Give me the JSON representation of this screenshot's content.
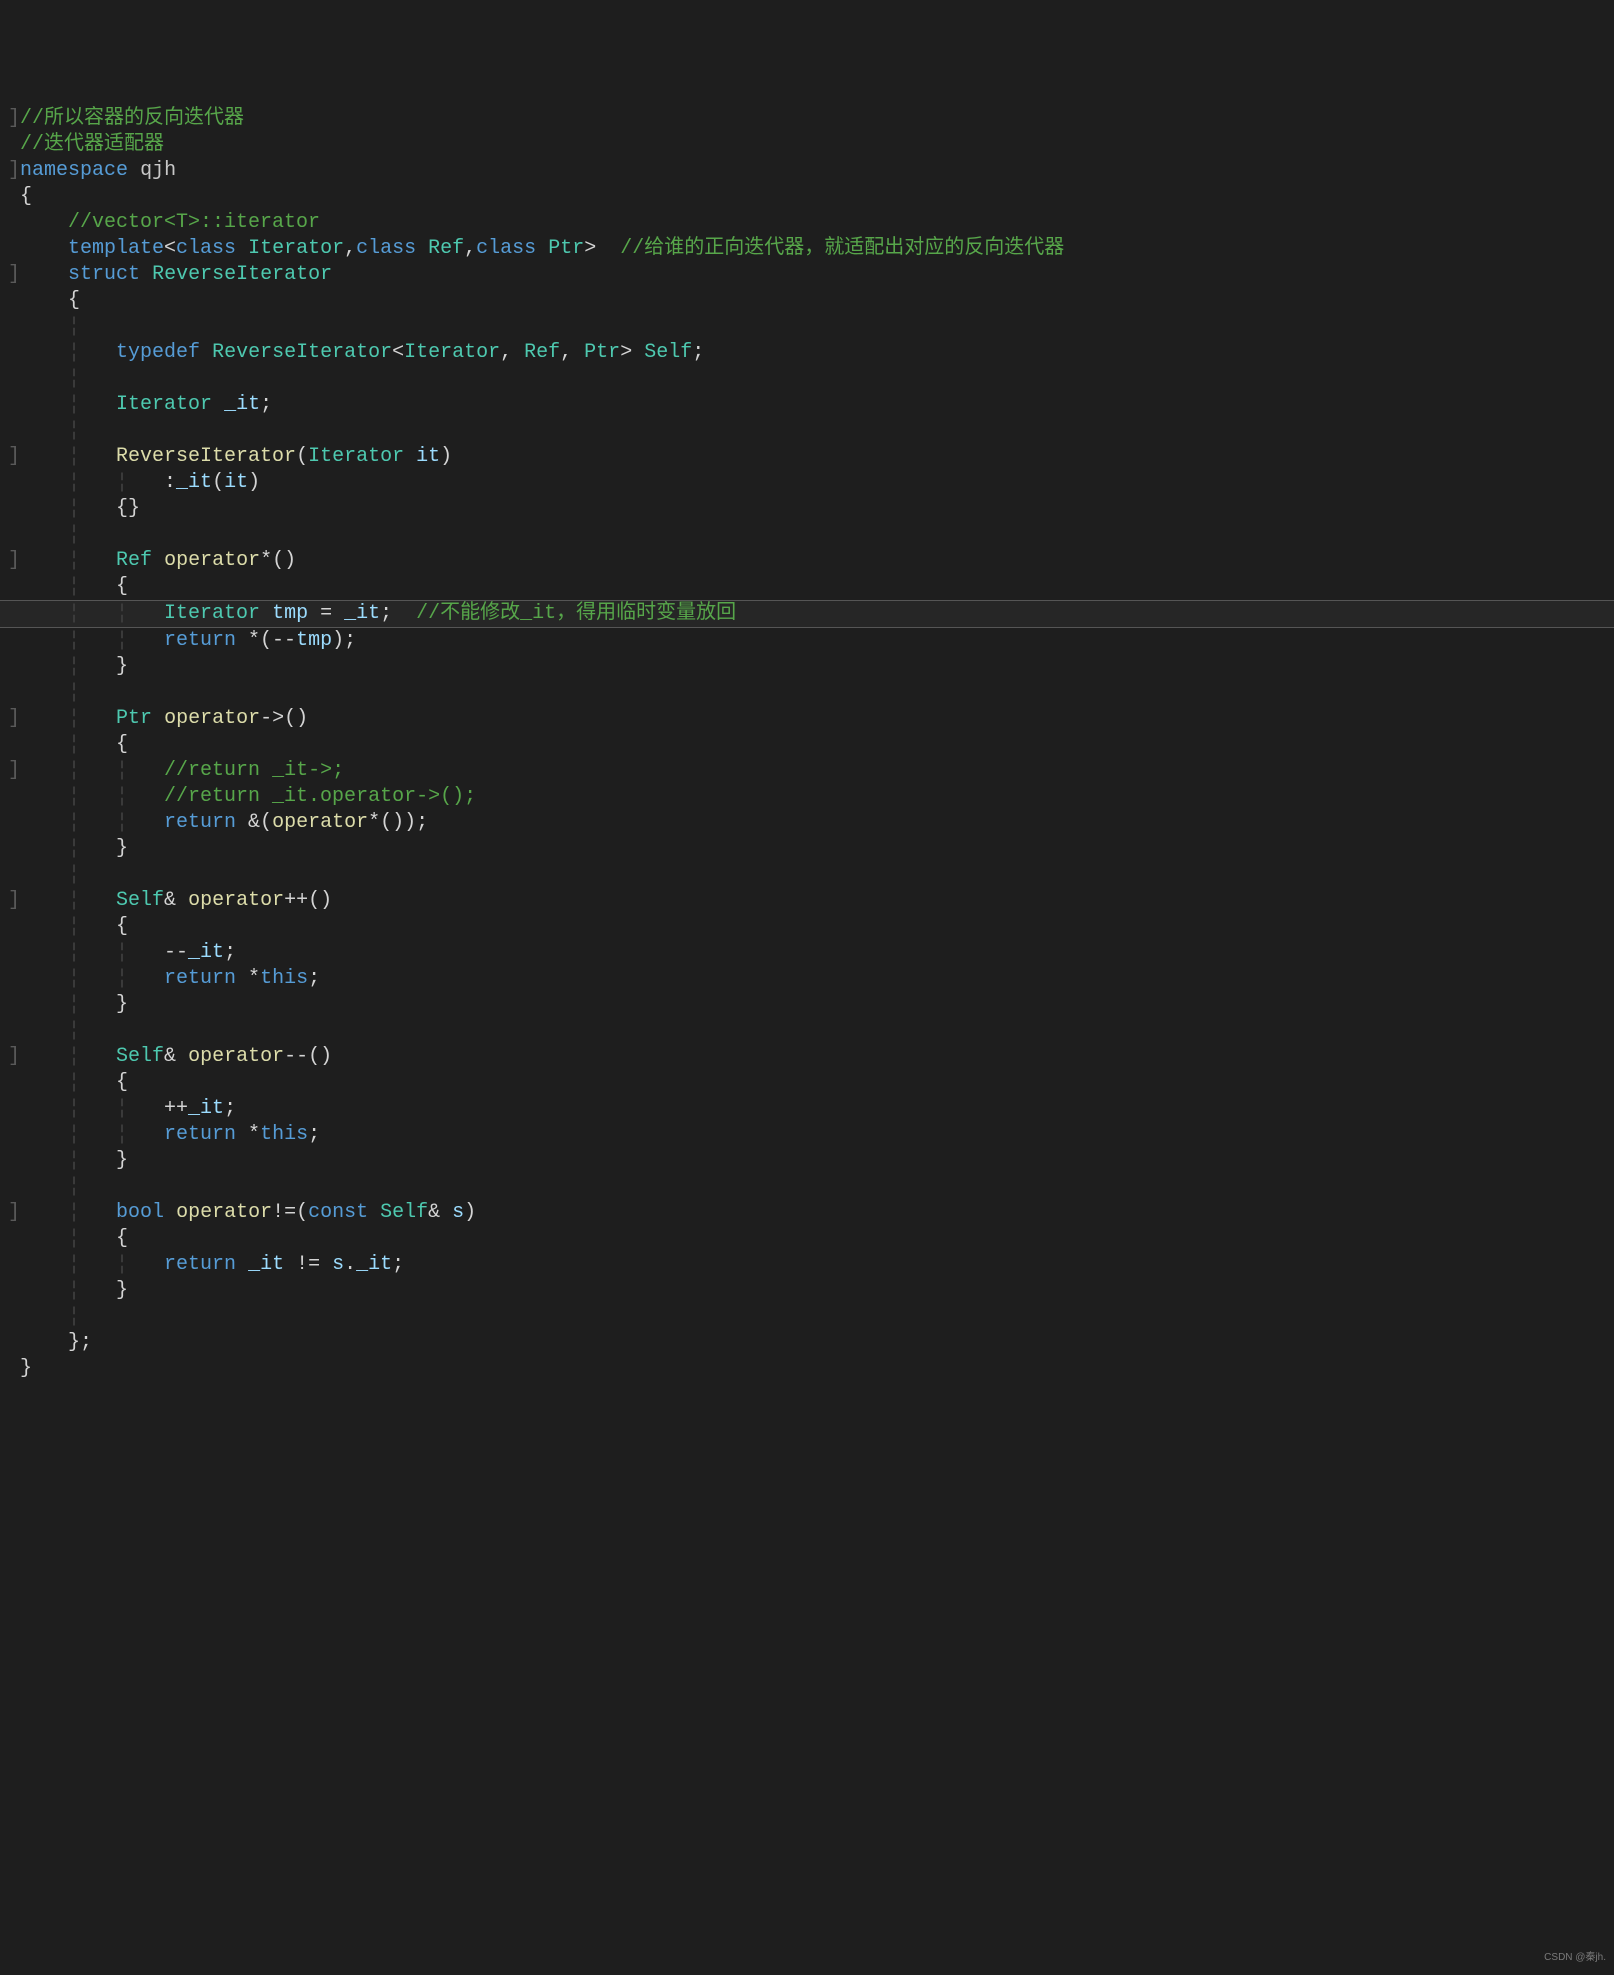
{
  "watermark": "CSDN @秦jh.",
  "lines": [
    {
      "hl": false,
      "tokens": [
        {
          "c": "c-mark",
          "t": "]"
        },
        {
          "c": "c-comment",
          "t": "//所以容器的反向迭代器"
        }
      ]
    },
    {
      "hl": false,
      "tokens": [
        {
          "c": "c-punct",
          "t": " "
        },
        {
          "c": "c-comment",
          "t": "//迭代器适配器"
        }
      ]
    },
    {
      "hl": false,
      "tokens": [
        {
          "c": "c-mark",
          "t": "]"
        },
        {
          "c": "c-keyword",
          "t": "namespace"
        },
        {
          "c": "c-punct",
          "t": " "
        },
        {
          "c": "c-ns",
          "t": "qjh"
        }
      ]
    },
    {
      "hl": false,
      "tokens": [
        {
          "c": "c-punct",
          "t": " {"
        }
      ]
    },
    {
      "hl": false,
      "tokens": [
        {
          "c": "c-punct",
          "t": "     "
        },
        {
          "c": "c-comment",
          "t": "//vector<T>::iterator"
        }
      ]
    },
    {
      "hl": false,
      "tokens": [
        {
          "c": "c-punct",
          "t": "     "
        },
        {
          "c": "c-keyword",
          "t": "template"
        },
        {
          "c": "c-punct",
          "t": "<"
        },
        {
          "c": "c-keyword",
          "t": "class"
        },
        {
          "c": "c-punct",
          "t": " "
        },
        {
          "c": "c-type",
          "t": "Iterator"
        },
        {
          "c": "c-punct",
          "t": ","
        },
        {
          "c": "c-keyword",
          "t": "class"
        },
        {
          "c": "c-punct",
          "t": " "
        },
        {
          "c": "c-type",
          "t": "Ref"
        },
        {
          "c": "c-punct",
          "t": ","
        },
        {
          "c": "c-keyword",
          "t": "class"
        },
        {
          "c": "c-punct",
          "t": " "
        },
        {
          "c": "c-type",
          "t": "Ptr"
        },
        {
          "c": "c-punct",
          "t": ">  "
        },
        {
          "c": "c-comment",
          "t": "//给谁的正向迭代器，就适配出对应的反向迭代器"
        }
      ]
    },
    {
      "hl": false,
      "tokens": [
        {
          "c": "c-mark",
          "t": "]"
        },
        {
          "c": "c-punct",
          "t": "    "
        },
        {
          "c": "c-keyword",
          "t": "struct"
        },
        {
          "c": "c-punct",
          "t": " "
        },
        {
          "c": "c-type",
          "t": "ReverseIterator"
        }
      ]
    },
    {
      "hl": false,
      "tokens": [
        {
          "c": "c-punct",
          "t": "     {"
        }
      ]
    },
    {
      "hl": false,
      "tokens": [
        {
          "c": "indent-guide",
          "t": "     ¦"
        }
      ]
    },
    {
      "hl": false,
      "tokens": [
        {
          "c": "indent-guide",
          "t": "     ¦   "
        },
        {
          "c": "c-keyword",
          "t": "typedef"
        },
        {
          "c": "c-punct",
          "t": " "
        },
        {
          "c": "c-type",
          "t": "ReverseIterator"
        },
        {
          "c": "c-punct",
          "t": "<"
        },
        {
          "c": "c-type",
          "t": "Iterator"
        },
        {
          "c": "c-punct",
          "t": ", "
        },
        {
          "c": "c-type",
          "t": "Ref"
        },
        {
          "c": "c-punct",
          "t": ", "
        },
        {
          "c": "c-type",
          "t": "Ptr"
        },
        {
          "c": "c-punct",
          "t": "> "
        },
        {
          "c": "c-type",
          "t": "Self"
        },
        {
          "c": "c-punct",
          "t": ";"
        }
      ]
    },
    {
      "hl": false,
      "tokens": [
        {
          "c": "indent-guide",
          "t": "     ¦"
        }
      ]
    },
    {
      "hl": false,
      "tokens": [
        {
          "c": "indent-guide",
          "t": "     ¦   "
        },
        {
          "c": "c-type",
          "t": "Iterator"
        },
        {
          "c": "c-punct",
          "t": " "
        },
        {
          "c": "c-var",
          "t": "_it"
        },
        {
          "c": "c-punct",
          "t": ";"
        }
      ]
    },
    {
      "hl": false,
      "tokens": [
        {
          "c": "indent-guide",
          "t": "     ¦"
        }
      ]
    },
    {
      "hl": false,
      "tokens": [
        {
          "c": "c-mark",
          "t": "]"
        },
        {
          "c": "indent-guide",
          "t": "    ¦   "
        },
        {
          "c": "c-ident",
          "t": "ReverseIterator"
        },
        {
          "c": "c-punct",
          "t": "("
        },
        {
          "c": "c-type",
          "t": "Iterator"
        },
        {
          "c": "c-punct",
          "t": " "
        },
        {
          "c": "c-var",
          "t": "it"
        },
        {
          "c": "c-punct",
          "t": ")"
        }
      ]
    },
    {
      "hl": false,
      "tokens": [
        {
          "c": "indent-guide",
          "t": "     ¦   ¦   "
        },
        {
          "c": "c-punct",
          "t": ":"
        },
        {
          "c": "c-var",
          "t": "_it"
        },
        {
          "c": "c-punct",
          "t": "("
        },
        {
          "c": "c-var",
          "t": "it"
        },
        {
          "c": "c-punct",
          "t": ")"
        }
      ]
    },
    {
      "hl": false,
      "tokens": [
        {
          "c": "indent-guide",
          "t": "     ¦   "
        },
        {
          "c": "c-punct",
          "t": "{}"
        }
      ]
    },
    {
      "hl": false,
      "tokens": [
        {
          "c": "indent-guide",
          "t": "     ¦"
        }
      ]
    },
    {
      "hl": false,
      "tokens": [
        {
          "c": "c-mark",
          "t": "]"
        },
        {
          "c": "indent-guide",
          "t": "    ¦   "
        },
        {
          "c": "c-type",
          "t": "Ref"
        },
        {
          "c": "c-punct",
          "t": " "
        },
        {
          "c": "c-ident",
          "t": "operator"
        },
        {
          "c": "c-punct",
          "t": "*()"
        }
      ]
    },
    {
      "hl": false,
      "tokens": [
        {
          "c": "indent-guide",
          "t": "     ¦   "
        },
        {
          "c": "c-punct",
          "t": "{"
        }
      ]
    },
    {
      "hl": true,
      "tokens": [
        {
          "c": "indent-guide",
          "t": "     ¦   ¦   "
        },
        {
          "c": "c-type",
          "t": "Iterator"
        },
        {
          "c": "c-punct",
          "t": " "
        },
        {
          "c": "c-var",
          "t": "tmp"
        },
        {
          "c": "c-punct",
          "t": " = "
        },
        {
          "c": "c-var",
          "t": "_it"
        },
        {
          "c": "c-punct",
          "t": ";  "
        },
        {
          "c": "c-comment",
          "t": "//不能修改_it，得用临时变量放回"
        }
      ]
    },
    {
      "hl": false,
      "tokens": [
        {
          "c": "indent-guide",
          "t": "     ¦   ¦   "
        },
        {
          "c": "c-keyword",
          "t": "return"
        },
        {
          "c": "c-punct",
          "t": " *(--"
        },
        {
          "c": "c-var",
          "t": "tmp"
        },
        {
          "c": "c-punct",
          "t": ");"
        }
      ]
    },
    {
      "hl": false,
      "tokens": [
        {
          "c": "indent-guide",
          "t": "     ¦   "
        },
        {
          "c": "c-punct",
          "t": "}"
        }
      ]
    },
    {
      "hl": false,
      "tokens": [
        {
          "c": "indent-guide",
          "t": "     ¦"
        }
      ]
    },
    {
      "hl": false,
      "tokens": [
        {
          "c": "c-mark",
          "t": "]"
        },
        {
          "c": "indent-guide",
          "t": "    ¦   "
        },
        {
          "c": "c-type",
          "t": "Ptr"
        },
        {
          "c": "c-punct",
          "t": " "
        },
        {
          "c": "c-ident",
          "t": "operator"
        },
        {
          "c": "c-punct",
          "t": "->()"
        }
      ]
    },
    {
      "hl": false,
      "tokens": [
        {
          "c": "indent-guide",
          "t": "     ¦   "
        },
        {
          "c": "c-punct",
          "t": "{"
        }
      ]
    },
    {
      "hl": false,
      "tokens": [
        {
          "c": "c-mark",
          "t": "]"
        },
        {
          "c": "indent-guide",
          "t": "    ¦   ¦   "
        },
        {
          "c": "c-comment",
          "t": "//return _it->;"
        }
      ]
    },
    {
      "hl": false,
      "tokens": [
        {
          "c": "indent-guide",
          "t": "     ¦   ¦   "
        },
        {
          "c": "c-comment",
          "t": "//return _it.operator->();"
        }
      ]
    },
    {
      "hl": false,
      "tokens": [
        {
          "c": "indent-guide",
          "t": "     ¦   ¦   "
        },
        {
          "c": "c-keyword",
          "t": "return"
        },
        {
          "c": "c-punct",
          "t": " &("
        },
        {
          "c": "c-ident",
          "t": "operator"
        },
        {
          "c": "c-punct",
          "t": "*());"
        }
      ]
    },
    {
      "hl": false,
      "tokens": [
        {
          "c": "indent-guide",
          "t": "     ¦   "
        },
        {
          "c": "c-punct",
          "t": "}"
        }
      ]
    },
    {
      "hl": false,
      "tokens": [
        {
          "c": "indent-guide",
          "t": "     ¦"
        }
      ]
    },
    {
      "hl": false,
      "tokens": [
        {
          "c": "c-mark",
          "t": "]"
        },
        {
          "c": "indent-guide",
          "t": "    ¦   "
        },
        {
          "c": "c-type",
          "t": "Self"
        },
        {
          "c": "c-punct",
          "t": "& "
        },
        {
          "c": "c-ident",
          "t": "operator"
        },
        {
          "c": "c-punct",
          "t": "++()"
        }
      ]
    },
    {
      "hl": false,
      "tokens": [
        {
          "c": "indent-guide",
          "t": "     ¦   "
        },
        {
          "c": "c-punct",
          "t": "{"
        }
      ]
    },
    {
      "hl": false,
      "tokens": [
        {
          "c": "indent-guide",
          "t": "     ¦   ¦   "
        },
        {
          "c": "c-punct",
          "t": "--"
        },
        {
          "c": "c-var",
          "t": "_it"
        },
        {
          "c": "c-punct",
          "t": ";"
        }
      ]
    },
    {
      "hl": false,
      "tokens": [
        {
          "c": "indent-guide",
          "t": "     ¦   ¦   "
        },
        {
          "c": "c-keyword",
          "t": "return"
        },
        {
          "c": "c-punct",
          "t": " *"
        },
        {
          "c": "c-keyword",
          "t": "this"
        },
        {
          "c": "c-punct",
          "t": ";"
        }
      ]
    },
    {
      "hl": false,
      "tokens": [
        {
          "c": "indent-guide",
          "t": "     ¦   "
        },
        {
          "c": "c-punct",
          "t": "}"
        }
      ]
    },
    {
      "hl": false,
      "tokens": [
        {
          "c": "indent-guide",
          "t": "     ¦"
        }
      ]
    },
    {
      "hl": false,
      "tokens": [
        {
          "c": "c-mark",
          "t": "]"
        },
        {
          "c": "indent-guide",
          "t": "    ¦   "
        },
        {
          "c": "c-type",
          "t": "Self"
        },
        {
          "c": "c-punct",
          "t": "& "
        },
        {
          "c": "c-ident",
          "t": "operator"
        },
        {
          "c": "c-punct",
          "t": "--()"
        }
      ]
    },
    {
      "hl": false,
      "tokens": [
        {
          "c": "indent-guide",
          "t": "     ¦   "
        },
        {
          "c": "c-punct",
          "t": "{"
        }
      ]
    },
    {
      "hl": false,
      "tokens": [
        {
          "c": "indent-guide",
          "t": "     ¦   ¦   "
        },
        {
          "c": "c-punct",
          "t": "++"
        },
        {
          "c": "c-var",
          "t": "_it"
        },
        {
          "c": "c-punct",
          "t": ";"
        }
      ]
    },
    {
      "hl": false,
      "tokens": [
        {
          "c": "indent-guide",
          "t": "     ¦   ¦   "
        },
        {
          "c": "c-keyword",
          "t": "return"
        },
        {
          "c": "c-punct",
          "t": " *"
        },
        {
          "c": "c-keyword",
          "t": "this"
        },
        {
          "c": "c-punct",
          "t": ";"
        }
      ]
    },
    {
      "hl": false,
      "tokens": [
        {
          "c": "indent-guide",
          "t": "     ¦   "
        },
        {
          "c": "c-punct",
          "t": "}"
        }
      ]
    },
    {
      "hl": false,
      "tokens": [
        {
          "c": "indent-guide",
          "t": "     ¦"
        }
      ]
    },
    {
      "hl": false,
      "tokens": [
        {
          "c": "c-mark",
          "t": "]"
        },
        {
          "c": "indent-guide",
          "t": "    ¦   "
        },
        {
          "c": "c-keyword",
          "t": "bool"
        },
        {
          "c": "c-punct",
          "t": " "
        },
        {
          "c": "c-ident",
          "t": "operator"
        },
        {
          "c": "c-punct",
          "t": "!=("
        },
        {
          "c": "c-keyword",
          "t": "const"
        },
        {
          "c": "c-punct",
          "t": " "
        },
        {
          "c": "c-type",
          "t": "Self"
        },
        {
          "c": "c-punct",
          "t": "& "
        },
        {
          "c": "c-var",
          "t": "s"
        },
        {
          "c": "c-punct",
          "t": ")"
        }
      ]
    },
    {
      "hl": false,
      "tokens": [
        {
          "c": "indent-guide",
          "t": "     ¦   "
        },
        {
          "c": "c-punct",
          "t": "{"
        }
      ]
    },
    {
      "hl": false,
      "tokens": [
        {
          "c": "indent-guide",
          "t": "     ¦   ¦   "
        },
        {
          "c": "c-keyword",
          "t": "return"
        },
        {
          "c": "c-punct",
          "t": " "
        },
        {
          "c": "c-var",
          "t": "_it"
        },
        {
          "c": "c-punct",
          "t": " != "
        },
        {
          "c": "c-var",
          "t": "s"
        },
        {
          "c": "c-punct",
          "t": "."
        },
        {
          "c": "c-var",
          "t": "_it"
        },
        {
          "c": "c-punct",
          "t": ";"
        }
      ]
    },
    {
      "hl": false,
      "tokens": [
        {
          "c": "indent-guide",
          "t": "     ¦   "
        },
        {
          "c": "c-punct",
          "t": "}"
        }
      ]
    },
    {
      "hl": false,
      "tokens": [
        {
          "c": "indent-guide",
          "t": "     ¦"
        }
      ]
    },
    {
      "hl": false,
      "tokens": [
        {
          "c": "c-punct",
          "t": "     };"
        }
      ]
    },
    {
      "hl": false,
      "tokens": [
        {
          "c": "c-punct",
          "t": " }"
        }
      ]
    }
  ]
}
